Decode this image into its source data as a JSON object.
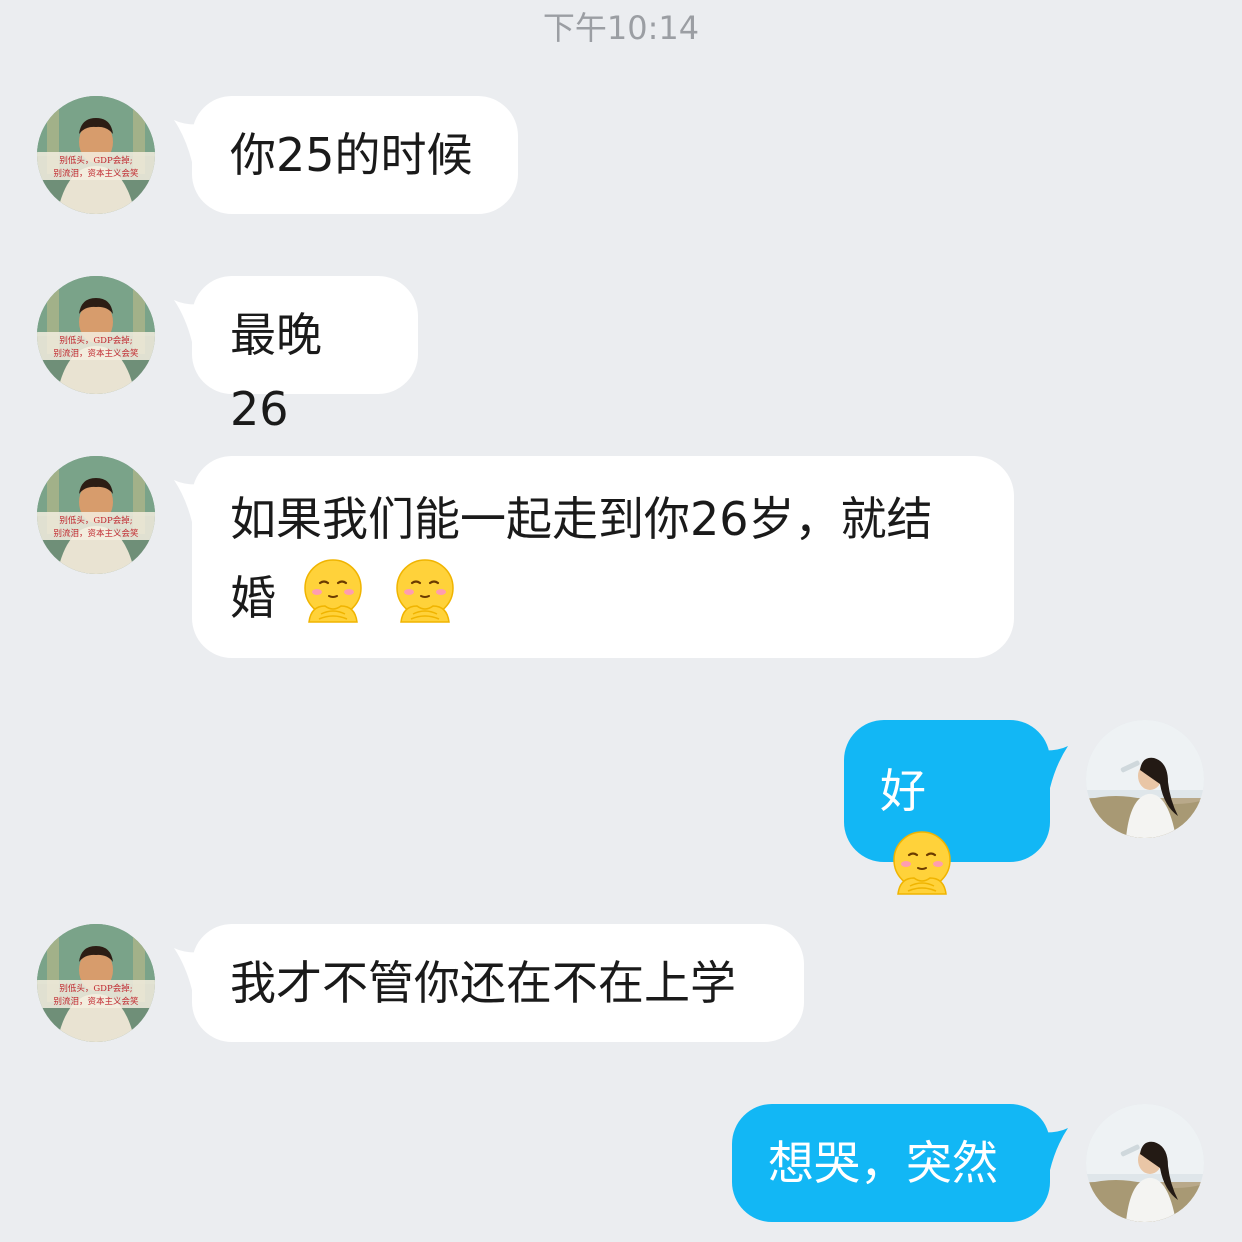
{
  "chat": {
    "timestamp": "下午10:14",
    "messages": [
      {
        "id": "m1",
        "side": "incoming",
        "text": "你25的时候",
        "emoji_count": 0
      },
      {
        "id": "m2",
        "side": "incoming",
        "text": "最晚26",
        "emoji_count": 0
      },
      {
        "id": "m3",
        "side": "incoming",
        "text_line1": "如果我们能一起走到你26岁，就结",
        "text_line2": "婚",
        "emoji_count": 2,
        "emoji": "blushing-hands-emoji"
      },
      {
        "id": "m4",
        "side": "outgoing",
        "text": "好",
        "emoji_count": 1,
        "emoji": "blushing-hands-emoji"
      },
      {
        "id": "m5",
        "side": "incoming",
        "text": "我才不管你还在不在上学",
        "emoji_count": 0
      },
      {
        "id": "m6",
        "side": "outgoing",
        "text": "想哭，突然",
        "emoji_count": 0
      }
    ],
    "avatar_caption_line1": "别低头，GDP会掉;",
    "avatar_caption_line2": "别流泪，资本主义会笑",
    "colors": {
      "background": "#ebedf0",
      "incoming_bubble": "#ffffff",
      "outgoing_bubble": "#12b7f5",
      "timestamp_text": "#9b9ea3"
    }
  }
}
